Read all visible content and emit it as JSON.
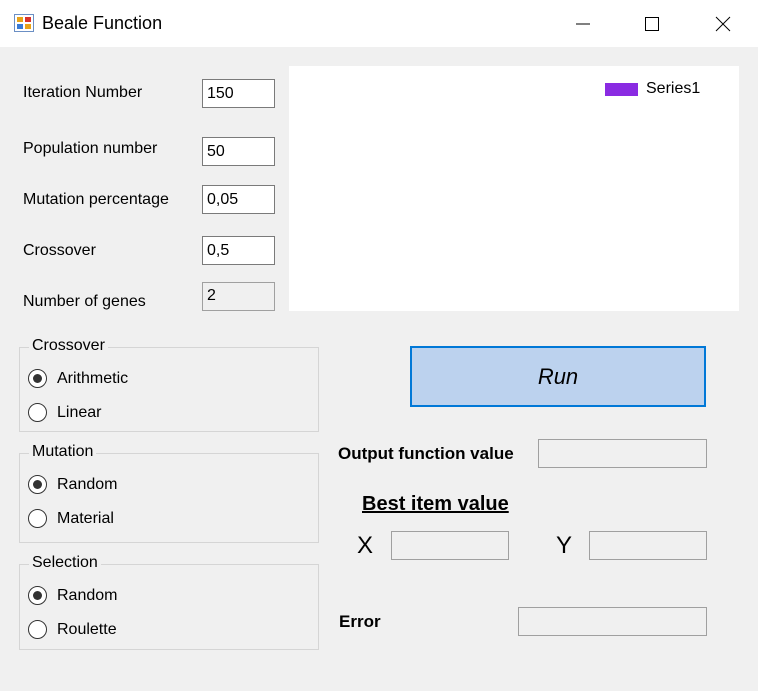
{
  "window": {
    "title": "Beale Function",
    "icon": "app-window-icon"
  },
  "params": [
    {
      "label": "Iteration Number",
      "value": "150"
    },
    {
      "label": "Population number",
      "value": "50"
    },
    {
      "label": "Mutation percentage",
      "value": "0,05"
    },
    {
      "label": "Crossover",
      "value": "0,5"
    },
    {
      "label": "Number of genes",
      "value": "2"
    }
  ],
  "chart": {
    "legend": "Series1",
    "series_color": "#8a2be2"
  },
  "groups": {
    "crossover": {
      "title": "Crossover",
      "options": [
        "Arithmetic",
        "Linear"
      ],
      "selected": "Arithmetic"
    },
    "mutation": {
      "title": "Mutation",
      "options": [
        "Random",
        "Material"
      ],
      "selected": "Random"
    },
    "selection": {
      "title": "Selection",
      "options": [
        "Random",
        "Roulette"
      ],
      "selected": "Random"
    }
  },
  "run_label": "Run",
  "output": {
    "function_value_label": "Output function value",
    "function_value": "",
    "best_heading": "Best item value",
    "x_label": "X",
    "x_value": "",
    "y_label": "Y",
    "y_value": "",
    "error_label": "Error",
    "error_value": ""
  },
  "colors": {
    "accent": "#0078d7",
    "run_bg": "#bcd2ee",
    "window_bg": "#f0f0f0"
  }
}
